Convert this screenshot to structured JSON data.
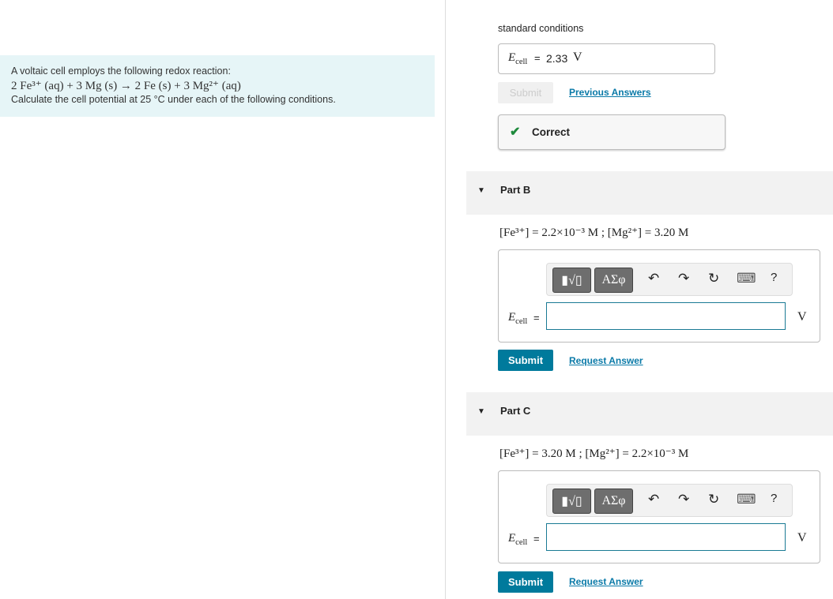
{
  "problem": {
    "intro": "A voltaic cell employs the following redox reaction:",
    "reaction": "2 Fe³⁺ (aq) + 3 Mg (s) → 2 Fe (s) + 3 Mg²⁺ (aq)",
    "instruction": "Calculate the cell potential at 25 °C under each of the following conditions."
  },
  "partA": {
    "condition": "standard conditions",
    "label_E": "E",
    "label_sub": "cell",
    "eq": "=",
    "value": "2.33",
    "unit": "V",
    "submit": "Submit",
    "link": "Previous Answers",
    "feedback": "Correct",
    "feedback_color": "#1e8a3c"
  },
  "partB": {
    "title": "Part B",
    "conditions": "[Fe³⁺] = 2.2×10⁻³ M ; [Mg²⁺] = 3.20 M",
    "label_E": "E",
    "label_sub": "cell",
    "eq": "=",
    "value": "",
    "unit": "V",
    "submit": "Submit",
    "link": "Request Answer"
  },
  "partC": {
    "title": "Part C",
    "conditions": "[Fe³⁺] = 3.20 M ; [Mg²⁺] = 2.2×10⁻³ M",
    "label_E": "E",
    "label_sub": "cell",
    "eq": "=",
    "value": "",
    "unit": "V",
    "submit": "Submit",
    "link": "Request Answer"
  },
  "toolbar": {
    "templates": "▮√▯",
    "greek": "ΑΣφ",
    "undo": "↶",
    "redo": "↷",
    "reset": "↻",
    "keyboard": "⌨",
    "help": "?"
  },
  "colors": {
    "accent": "#007a9c",
    "problem_bg": "#e6f5f7"
  }
}
